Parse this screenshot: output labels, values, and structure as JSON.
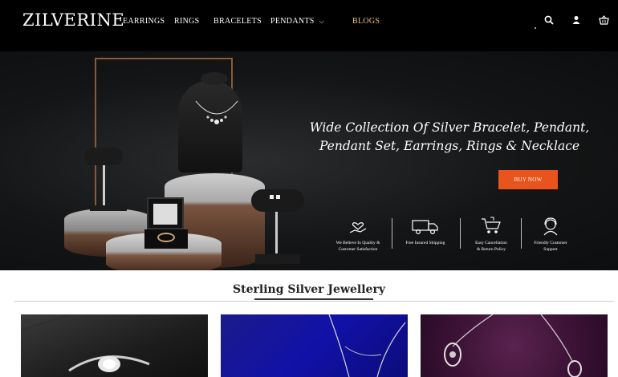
{
  "brand": {
    "logo": "ZILVERINE"
  },
  "nav": {
    "items": [
      {
        "label": "EARRINGS"
      },
      {
        "label": "RINGS"
      },
      {
        "label": "BRACELETS"
      },
      {
        "label": "PENDANTS"
      },
      {
        "label": "BLOGS"
      }
    ],
    "pendants_caret": "chevron-down",
    "accent_color": "#e8c57a"
  },
  "header_icons": [
    "search-icon",
    "user-icon",
    "basket-icon"
  ],
  "hero": {
    "title_line1": "Wide Collection Of  Silver Bracelet, Pendant,",
    "title_line2": "Pendant Set, Earrings, Rings & Necklace",
    "cta": "BUY NOW",
    "cta_color": "#e8541b",
    "features": [
      {
        "icon": "heart-hand-icon",
        "line1": "We Believe In Quality &",
        "line2": "Customer Satisfaction"
      },
      {
        "icon": "truck-icon",
        "line1": "Free Insured Shipping",
        "line2": ""
      },
      {
        "icon": "cart-return-icon",
        "line1": "Easy Cancellation",
        "line2": "& Return Policy"
      },
      {
        "icon": "support-person-icon",
        "line1": "Friendly Customer",
        "line2": "Support"
      }
    ]
  },
  "section": {
    "title": "Sterling Silver Jewellery"
  },
  "products": [
    {
      "image": "ring-on-dark-background"
    },
    {
      "image": "necklace-on-blue-background"
    },
    {
      "image": "pendant-on-purple-background"
    }
  ]
}
